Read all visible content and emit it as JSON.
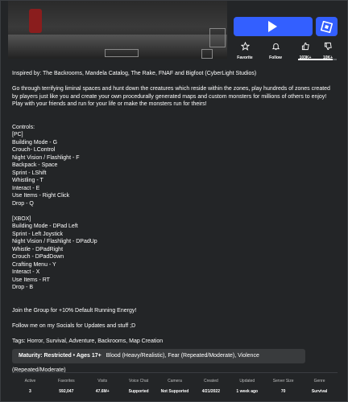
{
  "actions": {
    "favorite_label": "Favorite",
    "follow_label": "Follow",
    "upvotes": "103K+",
    "downvotes": "10K+",
    "upvote_fraction": 0.9
  },
  "description": {
    "lines": [
      "Inspired by: The Backrooms, Mandela Catalog, The Rake, FNAF and Bigfoot (CyberLight Studios)",
      "",
      "Go through terrifying liminal spaces and hunt down the creatures which reside within the zones, play hundreds of zones created by players just like you and create your own procedurally generated maps and custom monsters for millions of others to enjoy! Play with your friends and run for your life or make the monsters run for theirs!",
      "",
      "",
      "Controls:",
      "[PC]",
      "Building Mode - G",
      "Crouch- LControl",
      "Night Vision / Flashlight - F",
      "Backpack - Space",
      "Sprint - LShift",
      "Whistling - T",
      "Interact - E",
      "Use Items - Right Click",
      "Drop - Q",
      "",
      "[XBOX]",
      "Building Mode - DPad Left",
      "Sprint - Left Joystick",
      "Night Vision / Flashlight - DPadUp",
      "Whistle - DPadRight",
      "Crouch - DPadDown",
      "Crafting Menu - Y",
      "Interact - X",
      "Use Items - RT",
      "Drop - B",
      "",
      "",
      "Join the Group for +10% Default Running Energy!",
      "",
      "Follow me on my Socials for Updates and stuff ;D",
      "",
      "Tags: Horror, Survival, Adventure, Backrooms, Map Creation"
    ]
  },
  "maturity": {
    "label": "Maturity: Restricted • Ages 17+",
    "descriptors": "Blood (Heavy/Realistic), Fear (Repeated/Moderate), Violence (Repeated/Moderate)"
  },
  "stats": [
    {
      "header": "Active",
      "value": "3"
    },
    {
      "header": "Favorites",
      "value": "592,047"
    },
    {
      "header": "Visits",
      "value": "47.6M+"
    },
    {
      "header": "Voice Chat",
      "value": "Supported"
    },
    {
      "header": "Camera",
      "value": "Not Supported"
    },
    {
      "header": "Created",
      "value": "4/21/2022"
    },
    {
      "header": "Updated",
      "value": "1 week ago"
    },
    {
      "header": "Server Size",
      "value": "70"
    },
    {
      "header": "Genre",
      "value": "Survival"
    }
  ],
  "colors": {
    "background": "#232527",
    "play_button": "#335fff",
    "maturity_bg": "#393b3d",
    "text": "#ffffff",
    "muted": "#bdbebe"
  },
  "icons": {
    "play": "play-icon",
    "studio": "roblox-studio-icon",
    "favorite": "star-icon",
    "follow": "bell-icon",
    "upvote": "thumbs-up-icon",
    "downvote": "thumbs-down-icon"
  }
}
